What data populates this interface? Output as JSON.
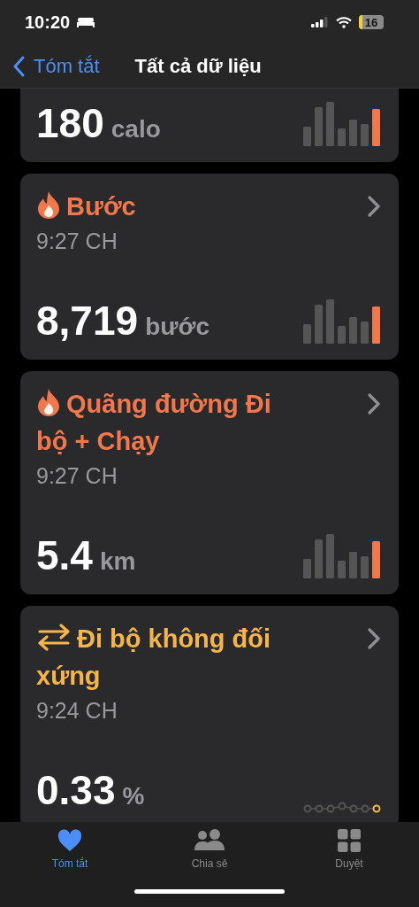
{
  "status_bar": {
    "time": "10:20",
    "battery": "16"
  },
  "nav": {
    "back": "Tóm tắt",
    "title": "Tất cả dữ liệu"
  },
  "cards": [
    {
      "kind": "activity",
      "value": "180",
      "unit": "calo"
    },
    {
      "kind": "activity",
      "title": "Bước",
      "color": "#f2784b",
      "time": "9:27 CH",
      "value": "8,719",
      "unit": "bước"
    },
    {
      "kind": "activity",
      "title": "Quãng đường Đi bộ + Chạy",
      "color": "#f2784b",
      "time": "9:27 CH",
      "value": "5.4",
      "unit": "km"
    },
    {
      "kind": "symmetry",
      "title": "Đi bộ không đối xứng",
      "color": "#f5b54a",
      "time": "9:24 CH",
      "value": "0.33",
      "unit": "%"
    }
  ],
  "tabs": [
    {
      "label": "Tóm tắt",
      "selected": true
    },
    {
      "label": "Chia sẻ",
      "selected": false
    },
    {
      "label": "Duyệt",
      "selected": false
    }
  ]
}
